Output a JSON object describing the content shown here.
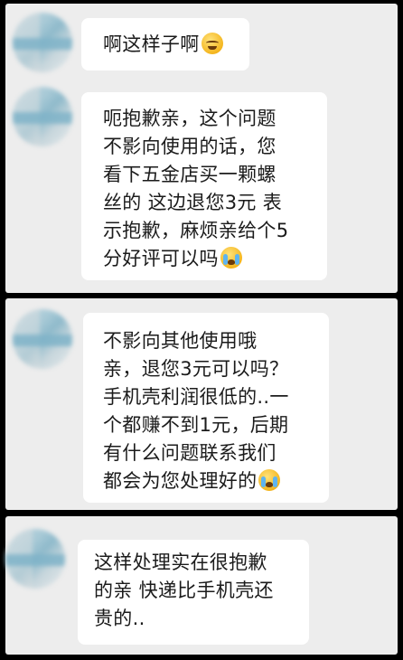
{
  "messages": [
    {
      "lines": [
        "啊这样子啊"
      ],
      "emoji": "sweat-face-emoji"
    },
    {
      "lines": [
        "呃抱歉亲，这个问题",
        "不影向使用的话，您",
        "看下五金店买一颗螺",
        "丝的 这边退您3元 表",
        "示抱歉，麻烦亲给个5",
        "分好评可以吗"
      ],
      "emoji": "crying-face-emoji"
    },
    {
      "lines": [
        "不影向其他使用哦",
        "亲，退您3元可以吗？",
        "手机壳利润很低的..一",
        "个都赚不到1元，后期",
        "有什么问题联系我们",
        "都会为您处理好的"
      ],
      "emoji": "crying-face-emoji"
    },
    {
      "lines": [
        "这样处理实在很抱歉",
        "的亲 快递比手机壳还",
        "贵的.."
      ]
    }
  ]
}
